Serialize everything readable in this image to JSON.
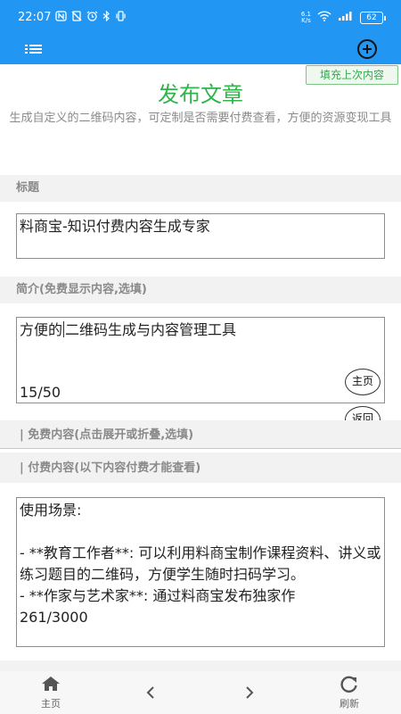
{
  "status_bar": {
    "time": "22:07",
    "speed_top": "6.1",
    "speed_bottom": "K/s",
    "battery": "62"
  },
  "header": {
    "menu_icon": "menu-icon",
    "add_icon": "plus-circle-icon",
    "fill_last_label": "填充上次内容"
  },
  "page": {
    "title": "发布文章",
    "subtitle": "生成自定义的二维码内容，可定制是否需要付费查看，方便的资源变现工具"
  },
  "form": {
    "title_label": "标题",
    "title_value": "料商宝-知识付费内容生成专家",
    "intro_label": "简介(免费显示内容,选填)",
    "intro_value_before_cursor": "方便的",
    "intro_value_after_cursor": "二维码生成与内容管理工具",
    "intro_count": "15/50",
    "free_label": "| 免费内容(点击展开或折叠,选填)",
    "paid_label": "| 付费内容(以下内容付费才能查看)",
    "paid_value": "使用场景:\n\n- **教育工作者**: 可以利用料商宝制作课程资料、讲义或练习题目的二维码，方便学生随时扫码学习。\n- **作家与艺术家**: 通过料商宝发布独家作",
    "paid_count": "261/3000"
  },
  "floating": {
    "home_label": "主页",
    "back_label": "返回"
  },
  "bottom_nav": {
    "home_label": "主页",
    "refresh_label": "刷新"
  },
  "colors": {
    "primary": "#2196f3",
    "title_green": "#30b34a",
    "label_gray": "#8a8a8a"
  }
}
